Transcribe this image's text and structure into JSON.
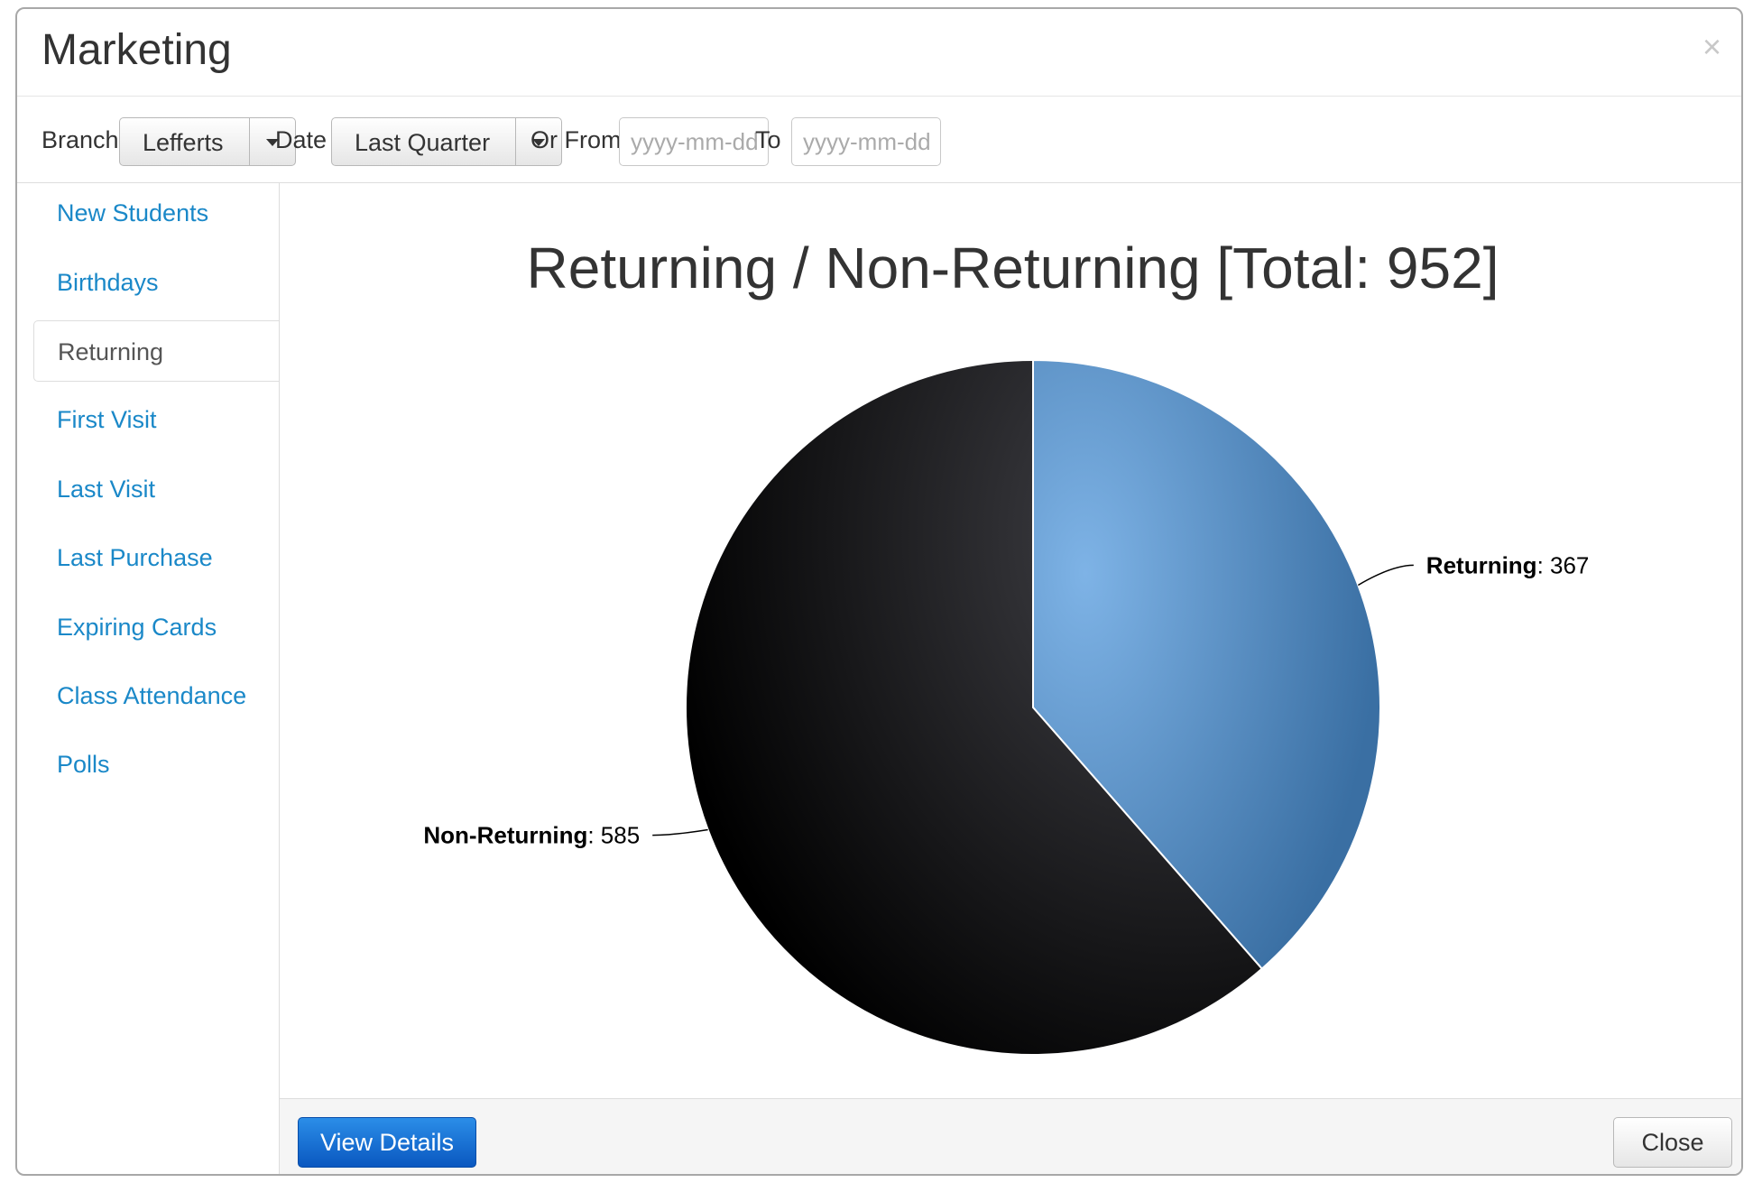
{
  "modal": {
    "title": "Marketing",
    "close_icon": "×"
  },
  "filters": {
    "branch_label": "Branch",
    "branch_value": "Lefferts",
    "date_label": "Date",
    "date_value": "Last Quarter",
    "from_label": "Or From",
    "from_placeholder": "yyyy-mm-dd",
    "to_label": "To",
    "to_placeholder": "yyyy-mm-dd"
  },
  "sidebar": {
    "items": [
      {
        "label": "New Students"
      },
      {
        "label": "Birthdays"
      },
      {
        "label": "Returning"
      },
      {
        "label": "First Visit"
      },
      {
        "label": "Last Visit"
      },
      {
        "label": "Last Purchase"
      },
      {
        "label": "Expiring Cards"
      },
      {
        "label": "Class Attendance"
      },
      {
        "label": "Polls"
      }
    ],
    "active_index": 2
  },
  "chart_data": {
    "type": "pie",
    "title": "Returning / Non-Returning [Total: 952]",
    "categories": [
      "Returning",
      "Non-Returning"
    ],
    "values": [
      367,
      585
    ],
    "colors": [
      "#4f86bd",
      "#1c1c1e"
    ],
    "labels": [
      "Returning",
      "Non-Returning"
    ]
  },
  "footer": {
    "view_details_label": "View Details",
    "close_label": "Close"
  }
}
